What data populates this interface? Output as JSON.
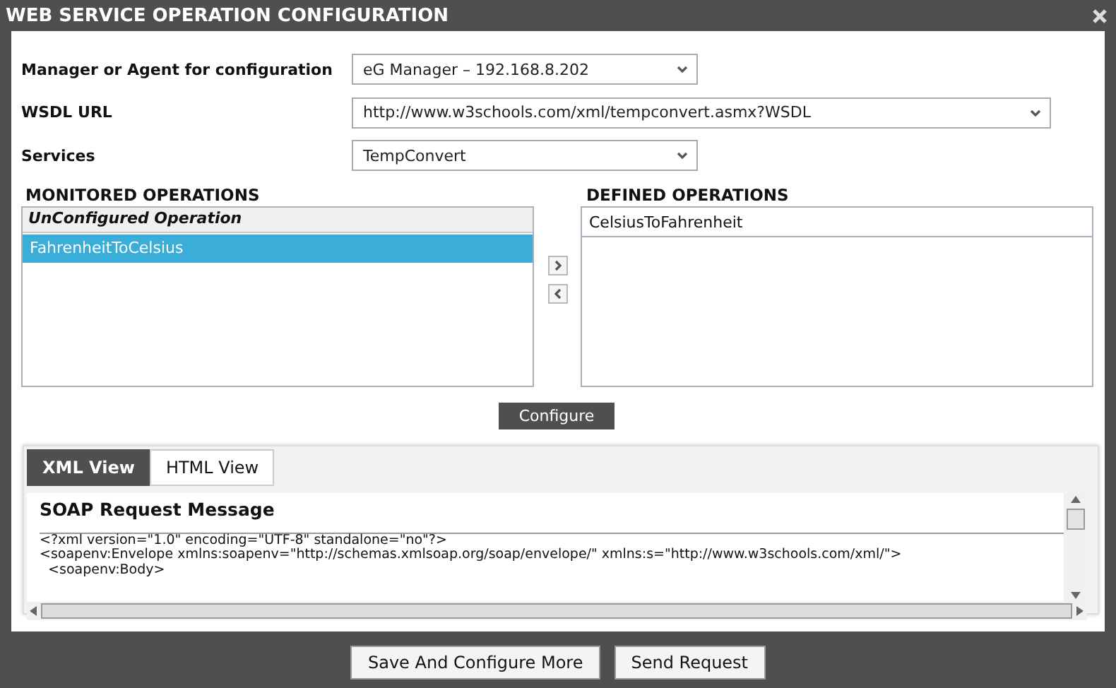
{
  "window": {
    "title": "WEB SERVICE OPERATION CONFIGURATION"
  },
  "fields": [
    {
      "label": "Manager or Agent for configuration",
      "value": "eG Manager – 192.168.8.202"
    },
    {
      "label": "WSDL URL",
      "value": "http://www.w3schools.com/xml/tempconvert.asmx?WSDL"
    },
    {
      "label": "Services",
      "value": "TempConvert"
    }
  ],
  "monitored": {
    "title": "MONITORED OPERATIONS",
    "header": "UnConfigured Operation",
    "items": [
      {
        "label": "FahrenheitToCelsius",
        "selected": true
      }
    ]
  },
  "defined": {
    "title": "DEFINED OPERATIONS",
    "items": [
      {
        "label": "CelsiusToFahrenheit",
        "selected": false
      }
    ]
  },
  "configure_button": "Configure",
  "tabs": [
    {
      "label": "XML View",
      "selected": true
    },
    {
      "label": "HTML View",
      "selected": false
    }
  ],
  "message": {
    "title": "SOAP Request Message",
    "lines": [
      "<?xml version=\"1.0\" encoding=\"UTF-8\" standalone=\"no\"?>",
      "<soapenv:Envelope xmlns:soapenv=\"http://schemas.xmlsoap.org/soap/envelope/\" xmlns:s=\"http://www.w3schools.com/xml/\">",
      "  <soapenv:Body>"
    ]
  },
  "footer_buttons": [
    "Save And Configure More",
    "Send Request"
  ]
}
